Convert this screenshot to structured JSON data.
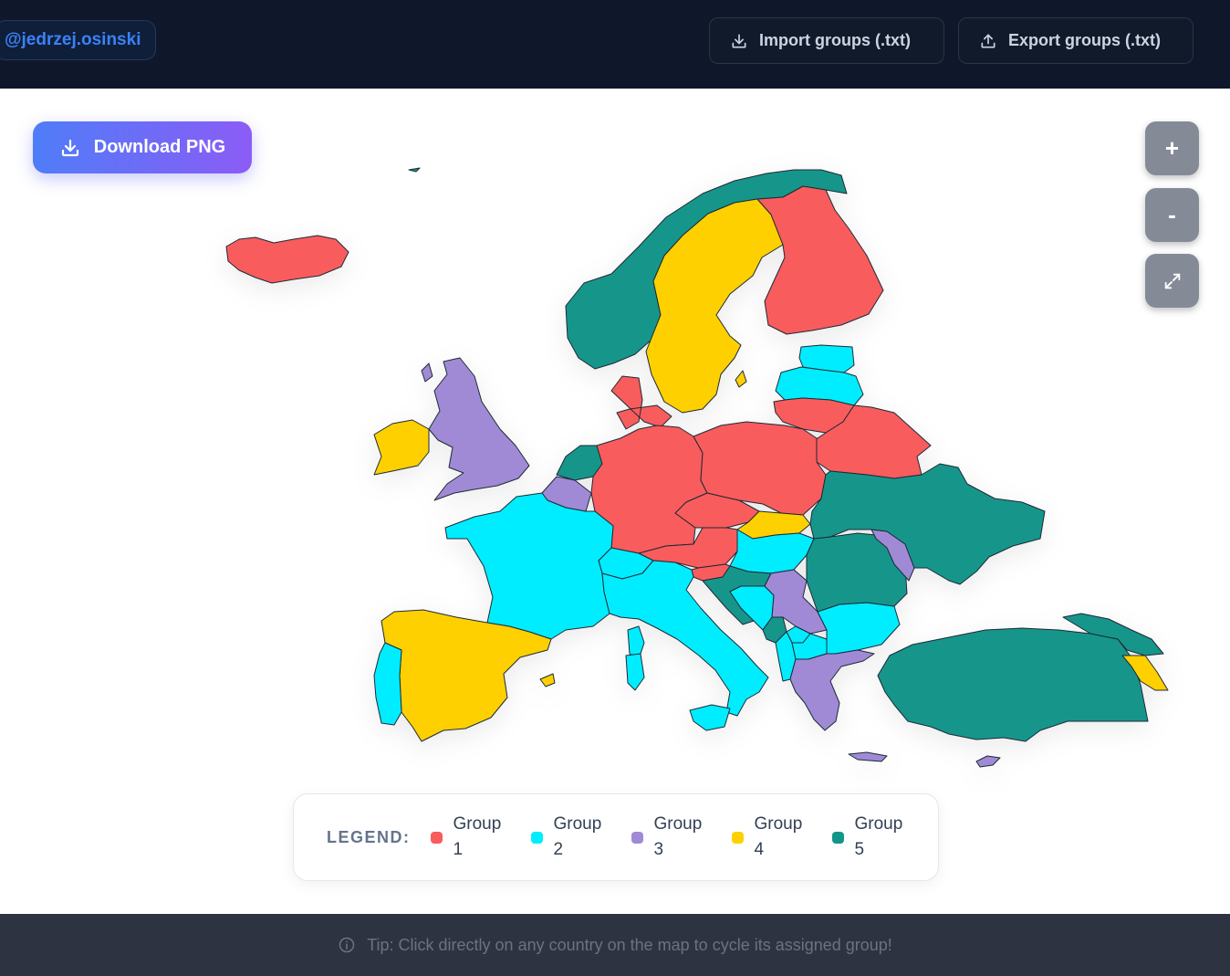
{
  "header": {
    "username": "@jedrzej.osinski",
    "import_label": "Import groups (.txt)",
    "export_label": "Export groups (.txt)"
  },
  "toolbar": {
    "download_label": "Download PNG",
    "zoom_in_label": "+",
    "zoom_out_label": "-",
    "fit_icon": "expand-icon"
  },
  "legend": {
    "title": "LEGEND:",
    "groups": [
      {
        "label": "Group 1",
        "color": "#f95c5c"
      },
      {
        "label": "Group 2",
        "color": "#00edff"
      },
      {
        "label": "Group 3",
        "color": "#a08ad6"
      },
      {
        "label": "Group 4",
        "color": "#ffd000"
      },
      {
        "label": "Group 5",
        "color": "#13968a"
      }
    ]
  },
  "map": {
    "countries": [
      {
        "name": "Iceland",
        "group": 1
      },
      {
        "name": "Norway",
        "group": 5
      },
      {
        "name": "Sweden",
        "group": 4
      },
      {
        "name": "Finland",
        "group": 1
      },
      {
        "name": "Estonia",
        "group": 2
      },
      {
        "name": "Latvia",
        "group": 2
      },
      {
        "name": "Lithuania",
        "group": 1
      },
      {
        "name": "Belarus",
        "group": 1
      },
      {
        "name": "United Kingdom",
        "group": 3
      },
      {
        "name": "Ireland",
        "group": 4
      },
      {
        "name": "Netherlands",
        "group": 5
      },
      {
        "name": "Belgium",
        "group": 3
      },
      {
        "name": "Denmark",
        "group": 1
      },
      {
        "name": "Germany",
        "group": 1
      },
      {
        "name": "Poland",
        "group": 1
      },
      {
        "name": "Czechia",
        "group": 1
      },
      {
        "name": "Slovakia",
        "group": 4
      },
      {
        "name": "Austria",
        "group": 1
      },
      {
        "name": "Hungary",
        "group": 2
      },
      {
        "name": "Slovenia",
        "group": 1
      },
      {
        "name": "Switzerland",
        "group": 2
      },
      {
        "name": "France",
        "group": 2
      },
      {
        "name": "Italy",
        "group": 2
      },
      {
        "name": "Croatia",
        "group": 5
      },
      {
        "name": "Bosnia and Herzegovina",
        "group": 2
      },
      {
        "name": "Serbia",
        "group": 3
      },
      {
        "name": "Montenegro",
        "group": 5
      },
      {
        "name": "Kosovo",
        "group": 2
      },
      {
        "name": "Albania",
        "group": 2
      },
      {
        "name": "North Macedonia",
        "group": 2
      },
      {
        "name": "Bulgaria",
        "group": 2
      },
      {
        "name": "Greece",
        "group": 3
      },
      {
        "name": "Romania",
        "group": 5
      },
      {
        "name": "Moldova",
        "group": 3
      },
      {
        "name": "Ukraine",
        "group": 5
      },
      {
        "name": "Turkey",
        "group": 5
      },
      {
        "name": "Cyprus",
        "group": 3
      },
      {
        "name": "Georgia",
        "group": 5
      },
      {
        "name": "Armenia",
        "group": 4
      },
      {
        "name": "Spain",
        "group": 4
      },
      {
        "name": "Portugal",
        "group": 2
      }
    ]
  },
  "footer": {
    "tip": "Tip: Click directly on any country on the map to cycle its assigned group!"
  }
}
